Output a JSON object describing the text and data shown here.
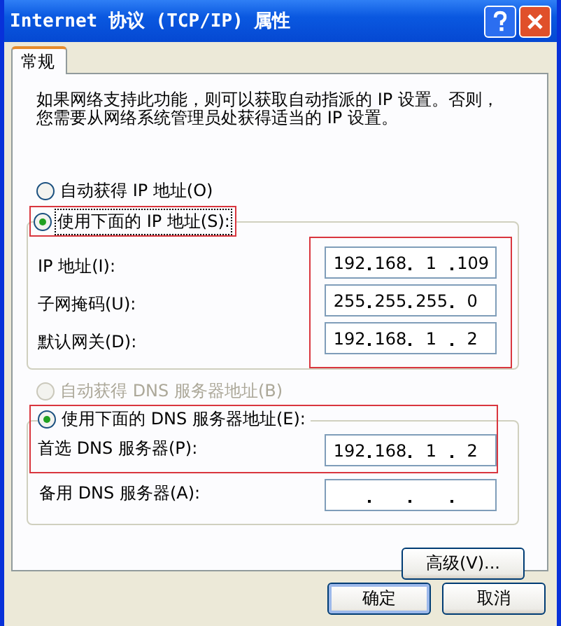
{
  "window": {
    "title": "Internet 协议 (TCP/IP) 属性"
  },
  "tabs": [
    {
      "label": "常规",
      "selected": true
    }
  ],
  "description": "如果网络支持此功能，则可以获取自动指派的 IP 设置。否则，您需要从网络系统管理员处获得适当的 IP 设置。",
  "ip": {
    "options": [
      {
        "label": "自动获得 IP 地址(O)",
        "selected": false,
        "disabled": false,
        "highlighted": false
      },
      {
        "label": "使用下面的 IP 地址(S):",
        "selected": true,
        "disabled": false,
        "highlighted": true
      }
    ],
    "fields_highlighted": true,
    "fields": [
      {
        "label": "IP 地址(I):",
        "octets": [
          "192",
          "168",
          "1",
          "109"
        ]
      },
      {
        "label": "子网掩码(U):",
        "octets": [
          "255",
          "255",
          "255",
          "0"
        ]
      },
      {
        "label": "默认网关(D):",
        "octets": [
          "192",
          "168",
          "1",
          "2"
        ]
      }
    ]
  },
  "dns": {
    "options": [
      {
        "label": "自动获得 DNS 服务器地址(B)",
        "selected": false,
        "disabled": true,
        "highlighted": false
      },
      {
        "label": "使用下面的 DNS 服务器地址(E):",
        "selected": true,
        "disabled": false,
        "highlighted": true
      }
    ],
    "fields": [
      {
        "label": "首选 DNS 服务器(P):",
        "octets": [
          "192",
          "168",
          "1",
          "2"
        ],
        "highlighted": true
      },
      {
        "label": "备用 DNS 服务器(A):",
        "highlighted": false
      }
    ]
  },
  "advanced_button": "高级(V)...",
  "buttons": [
    "确定",
    "取消"
  ]
}
